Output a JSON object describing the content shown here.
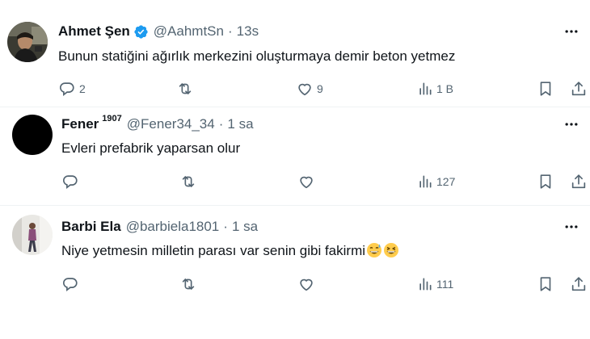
{
  "tweets": [
    {
      "name": "Ahmet Şen",
      "verified": true,
      "handle": "@AahmtSn",
      "time": "13s",
      "text": "Bunun statiğini ağırlık merkezini oluşturmaya demir beton yetmez",
      "replies": "2",
      "retweets": "",
      "likes": "9",
      "views": "1 B"
    },
    {
      "name": "Fener",
      "name_sup": "1907",
      "handle": "@Fener34_34",
      "time": "1 sa",
      "text": "Evleri prefabrik yaparsan olur",
      "replies": "",
      "retweets": "",
      "likes": "",
      "views": "127"
    },
    {
      "name": "Barbi Ela",
      "handle": "@barbiela1801",
      "time": "1 sa",
      "text": "Niye yetmesin milletin parası var senin gibi fakirmi",
      "emojis": [
        "grinning-sweat-emoji",
        "laughing-emoji"
      ],
      "replies": "",
      "retweets": "",
      "likes": "",
      "views": "111"
    }
  ],
  "dot_separator": "·",
  "colors": {
    "text": "#0f1419",
    "muted": "#536471",
    "verified": "#1d9bf0",
    "divider": "#eff3f4"
  }
}
